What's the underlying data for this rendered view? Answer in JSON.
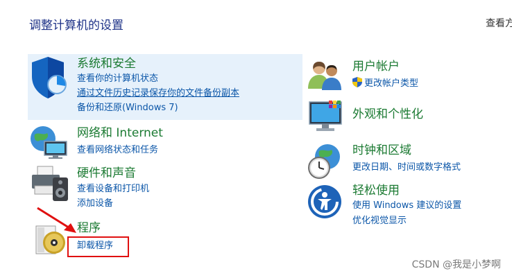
{
  "header": {
    "title": "调整计算机的设置",
    "view_by": "查看方"
  },
  "categories": {
    "system_security": {
      "title": "系统和安全",
      "links": [
        "查看你的计算机状态",
        "通过文件历史记录保存你的文件备份副本",
        "备份和还原(Windows 7)"
      ]
    },
    "network": {
      "title": "网络和 Internet",
      "links": [
        "查看网络状态和任务"
      ]
    },
    "hardware": {
      "title": "硬件和声音",
      "links": [
        "查看设备和打印机",
        "添加设备"
      ]
    },
    "programs": {
      "title": "程序",
      "links": [
        "卸载程序"
      ]
    },
    "user_accounts": {
      "title": "用户帐户",
      "links": [
        "更改帐户类型"
      ]
    },
    "appearance": {
      "title": "外观和个性化",
      "links": []
    },
    "clock_region": {
      "title": "时钟和区域",
      "links": [
        "更改日期、时间或数字格式"
      ]
    },
    "ease_of_access": {
      "title": "轻松使用",
      "links": [
        "使用 Windows 建议的设置",
        "优化视觉显示"
      ]
    }
  },
  "watermark": "CSDN @我是小梦啊",
  "colors": {
    "category_title": "#1b7a32",
    "link": "#0b56a8",
    "page_title": "#1e3287",
    "highlight": "#e6f1fb",
    "annotation": "#e01010"
  },
  "icons": {
    "system_security": "shield-icon",
    "network": "globe-network-icon",
    "hardware": "printer-speaker-icon",
    "programs": "program-disc-icon",
    "user_accounts": "users-icon",
    "appearance": "monitor-color-icon",
    "clock_region": "clock-globe-icon",
    "ease_of_access": "ease-access-icon"
  }
}
